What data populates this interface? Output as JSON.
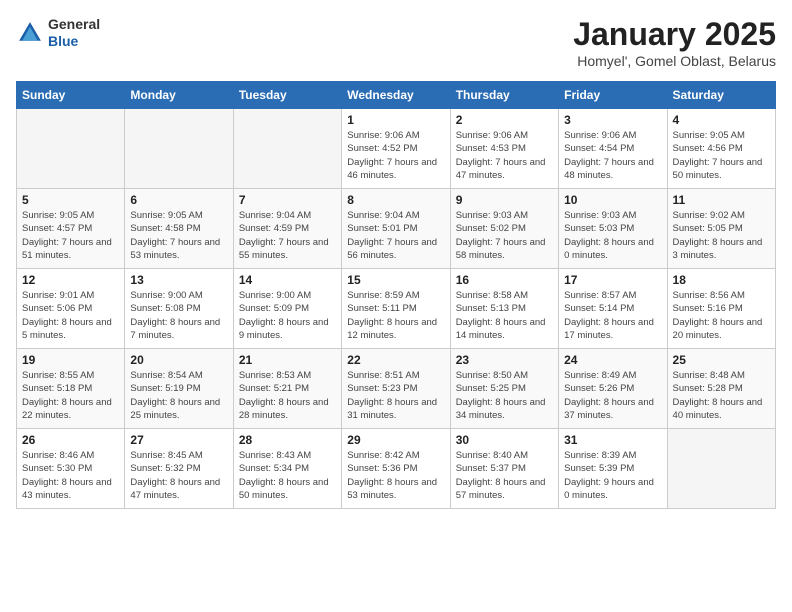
{
  "header": {
    "logo_general": "General",
    "logo_blue": "Blue",
    "title": "January 2025",
    "subtitle": "Homyel', Gomel Oblast, Belarus"
  },
  "days_of_week": [
    "Sunday",
    "Monday",
    "Tuesday",
    "Wednesday",
    "Thursday",
    "Friday",
    "Saturday"
  ],
  "weeks": [
    [
      {
        "day": "",
        "info": ""
      },
      {
        "day": "",
        "info": ""
      },
      {
        "day": "",
        "info": ""
      },
      {
        "day": "1",
        "info": "Sunrise: 9:06 AM\nSunset: 4:52 PM\nDaylight: 7 hours and 46 minutes."
      },
      {
        "day": "2",
        "info": "Sunrise: 9:06 AM\nSunset: 4:53 PM\nDaylight: 7 hours and 47 minutes."
      },
      {
        "day": "3",
        "info": "Sunrise: 9:06 AM\nSunset: 4:54 PM\nDaylight: 7 hours and 48 minutes."
      },
      {
        "day": "4",
        "info": "Sunrise: 9:05 AM\nSunset: 4:56 PM\nDaylight: 7 hours and 50 minutes."
      }
    ],
    [
      {
        "day": "5",
        "info": "Sunrise: 9:05 AM\nSunset: 4:57 PM\nDaylight: 7 hours and 51 minutes."
      },
      {
        "day": "6",
        "info": "Sunrise: 9:05 AM\nSunset: 4:58 PM\nDaylight: 7 hours and 53 minutes."
      },
      {
        "day": "7",
        "info": "Sunrise: 9:04 AM\nSunset: 4:59 PM\nDaylight: 7 hours and 55 minutes."
      },
      {
        "day": "8",
        "info": "Sunrise: 9:04 AM\nSunset: 5:01 PM\nDaylight: 7 hours and 56 minutes."
      },
      {
        "day": "9",
        "info": "Sunrise: 9:03 AM\nSunset: 5:02 PM\nDaylight: 7 hours and 58 minutes."
      },
      {
        "day": "10",
        "info": "Sunrise: 9:03 AM\nSunset: 5:03 PM\nDaylight: 8 hours and 0 minutes."
      },
      {
        "day": "11",
        "info": "Sunrise: 9:02 AM\nSunset: 5:05 PM\nDaylight: 8 hours and 3 minutes."
      }
    ],
    [
      {
        "day": "12",
        "info": "Sunrise: 9:01 AM\nSunset: 5:06 PM\nDaylight: 8 hours and 5 minutes."
      },
      {
        "day": "13",
        "info": "Sunrise: 9:00 AM\nSunset: 5:08 PM\nDaylight: 8 hours and 7 minutes."
      },
      {
        "day": "14",
        "info": "Sunrise: 9:00 AM\nSunset: 5:09 PM\nDaylight: 8 hours and 9 minutes."
      },
      {
        "day": "15",
        "info": "Sunrise: 8:59 AM\nSunset: 5:11 PM\nDaylight: 8 hours and 12 minutes."
      },
      {
        "day": "16",
        "info": "Sunrise: 8:58 AM\nSunset: 5:13 PM\nDaylight: 8 hours and 14 minutes."
      },
      {
        "day": "17",
        "info": "Sunrise: 8:57 AM\nSunset: 5:14 PM\nDaylight: 8 hours and 17 minutes."
      },
      {
        "day": "18",
        "info": "Sunrise: 8:56 AM\nSunset: 5:16 PM\nDaylight: 8 hours and 20 minutes."
      }
    ],
    [
      {
        "day": "19",
        "info": "Sunrise: 8:55 AM\nSunset: 5:18 PM\nDaylight: 8 hours and 22 minutes."
      },
      {
        "day": "20",
        "info": "Sunrise: 8:54 AM\nSunset: 5:19 PM\nDaylight: 8 hours and 25 minutes."
      },
      {
        "day": "21",
        "info": "Sunrise: 8:53 AM\nSunset: 5:21 PM\nDaylight: 8 hours and 28 minutes."
      },
      {
        "day": "22",
        "info": "Sunrise: 8:51 AM\nSunset: 5:23 PM\nDaylight: 8 hours and 31 minutes."
      },
      {
        "day": "23",
        "info": "Sunrise: 8:50 AM\nSunset: 5:25 PM\nDaylight: 8 hours and 34 minutes."
      },
      {
        "day": "24",
        "info": "Sunrise: 8:49 AM\nSunset: 5:26 PM\nDaylight: 8 hours and 37 minutes."
      },
      {
        "day": "25",
        "info": "Sunrise: 8:48 AM\nSunset: 5:28 PM\nDaylight: 8 hours and 40 minutes."
      }
    ],
    [
      {
        "day": "26",
        "info": "Sunrise: 8:46 AM\nSunset: 5:30 PM\nDaylight: 8 hours and 43 minutes."
      },
      {
        "day": "27",
        "info": "Sunrise: 8:45 AM\nSunset: 5:32 PM\nDaylight: 8 hours and 47 minutes."
      },
      {
        "day": "28",
        "info": "Sunrise: 8:43 AM\nSunset: 5:34 PM\nDaylight: 8 hours and 50 minutes."
      },
      {
        "day": "29",
        "info": "Sunrise: 8:42 AM\nSunset: 5:36 PM\nDaylight: 8 hours and 53 minutes."
      },
      {
        "day": "30",
        "info": "Sunrise: 8:40 AM\nSunset: 5:37 PM\nDaylight: 8 hours and 57 minutes."
      },
      {
        "day": "31",
        "info": "Sunrise: 8:39 AM\nSunset: 5:39 PM\nDaylight: 9 hours and 0 minutes."
      },
      {
        "day": "",
        "info": ""
      }
    ]
  ]
}
